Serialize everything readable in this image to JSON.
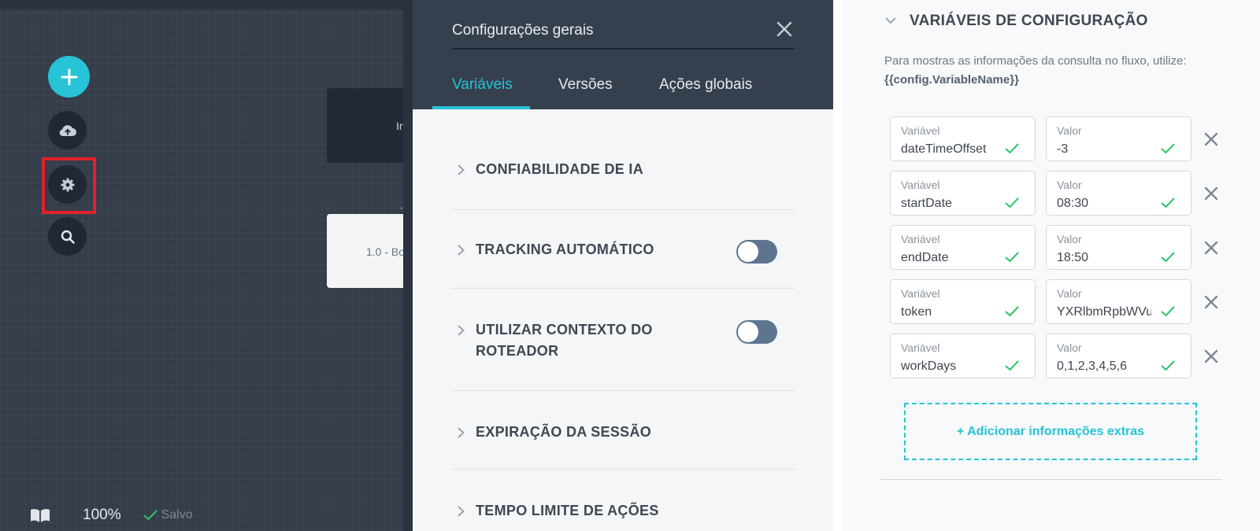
{
  "canvas": {
    "tools": [
      {
        "name": "add",
        "icon": "plus-icon"
      },
      {
        "name": "publish",
        "icon": "cloud-upload-icon"
      },
      {
        "name": "settings",
        "icon": "gear-icon"
      },
      {
        "name": "search",
        "icon": "search-icon"
      }
    ],
    "flow_card_1_text": "In",
    "flow_card_2_text": "1.0 - Bo",
    "zoom": "100%",
    "saved_label": "Salvo"
  },
  "settings_panel": {
    "title": "Configurações gerais",
    "tabs": [
      {
        "label": "Variáveis",
        "active": true
      },
      {
        "label": "Versões",
        "active": false
      },
      {
        "label": "Ações globais",
        "active": false
      }
    ],
    "sections": [
      {
        "title": "CONFIABILIDADE DE IA",
        "has_toggle": false
      },
      {
        "title": "TRACKING AUTOMÁTICO",
        "has_toggle": true,
        "toggle_on": false
      },
      {
        "title_line1": "UTILIZAR CONTEXTO DO",
        "title_line2": "ROTEADOR",
        "has_toggle": true,
        "toggle_on": false
      },
      {
        "title": "EXPIRAÇÃO DA SESSÃO",
        "has_toggle": false
      },
      {
        "title": "TEMPO LIMITE DE AÇÕES",
        "has_toggle": false
      }
    ]
  },
  "config_variables": {
    "title": "VARIÁVEIS DE CONFIGURAÇÃO",
    "help_text": "Para mostras as informações da consulta no fluxo, utilize:",
    "help_code": "{{config.VariableName}}",
    "key_label": "Variável",
    "value_label": "Valor",
    "rows": [
      {
        "key": "dateTimeOffset",
        "value": "-3"
      },
      {
        "key": "startDate",
        "value": "08:30"
      },
      {
        "key": "endDate",
        "value": "18:50"
      },
      {
        "key": "token",
        "value": "YXRlbmRpbWVudG"
      },
      {
        "key": "workDays",
        "value": "0,1,2,3,4,5,6"
      }
    ],
    "add_button": "+ Adicionar informações extras"
  },
  "colors": {
    "accent": "#27c3d7",
    "highlight": "#e3202a",
    "success": "#2ec36a",
    "header_bg": "#363f4d"
  }
}
